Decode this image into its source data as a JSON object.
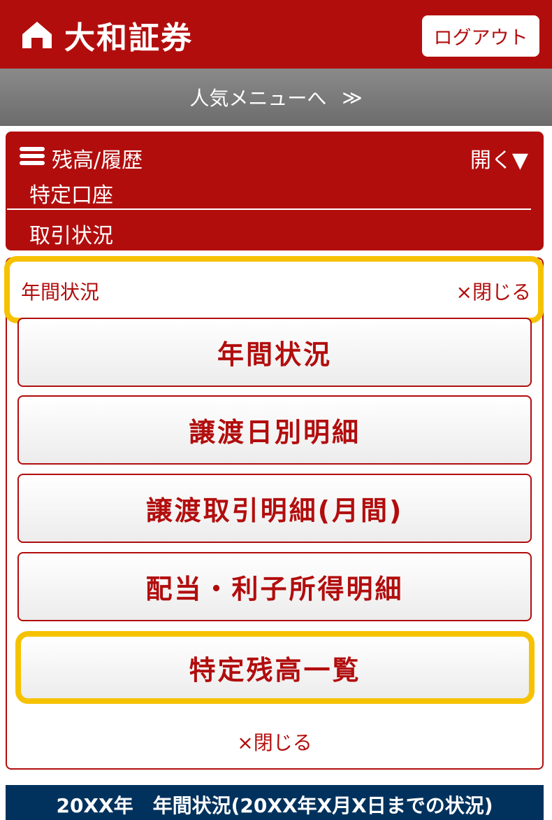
{
  "header": {
    "brand": "大和証券",
    "logout_label": "ログアウト"
  },
  "popular_menu": {
    "label": "人気メニューへ",
    "chevron": "≫"
  },
  "balance_panel": {
    "title": "残高/履歴",
    "open_label": "開く▼",
    "items": [
      "特定口座",
      "取引状況"
    ]
  },
  "annual": {
    "header_label": "年間状況",
    "close_label": "×閉じる",
    "buttons": [
      "年間状況",
      "譲渡日別明細",
      "譲渡取引明細(月間)",
      "配当・利子所得明細",
      "特定残高一覧"
    ],
    "bottom_close_label": "×閉じる"
  },
  "status_bar": {
    "text": "20XX年　年間状況(20XX年X月X日までの状況)"
  },
  "colors": {
    "brand_red": "#b20d0d",
    "highlight_yellow": "#f6c200",
    "navy": "#00325d",
    "gray_bar": "#7a7a7a"
  },
  "icons": [
    "home-icon",
    "hamburger-icon"
  ]
}
